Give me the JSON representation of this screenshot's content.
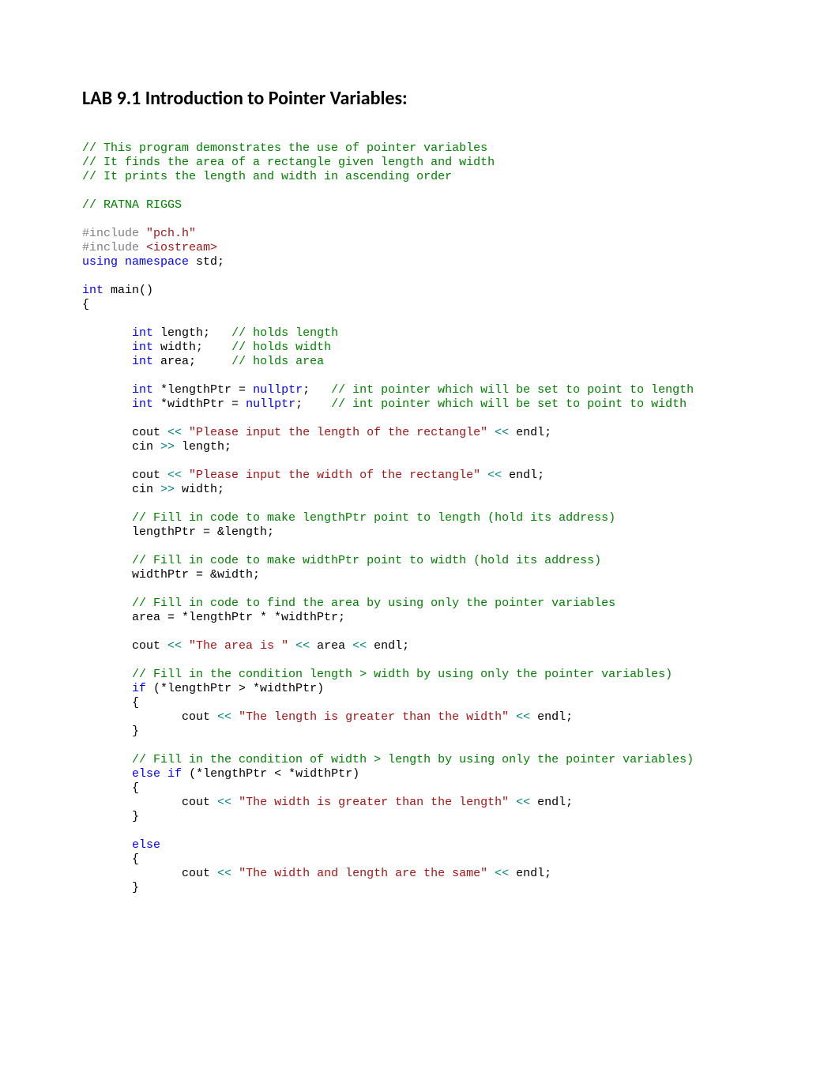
{
  "title": "LAB 9.1 Introduction to Pointer Variables:",
  "code": {
    "c1": "// This program demonstrates the use of pointer variables",
    "c2": "// It finds the area of a rectangle given length and width",
    "c3": "// It prints the length and width in ascending order",
    "c4": "// RATNA RIGGS",
    "inc": "#include",
    "pch": "\"pch.h\"",
    "ios": "<iostream>",
    "using": "using",
    "ns": "namespace",
    "std": " std;",
    "int": "int",
    "main": " main()",
    "lb": "{",
    "rb": "}",
    "length_decl": " length;   ",
    "c_len": "// holds length",
    "width_decl": " width;    ",
    "c_wid": "// holds width",
    "area_decl": " area;     ",
    "c_area": "// holds area",
    "lptr_decl": " *lengthPtr = ",
    "nullptr": "nullptr",
    "semic": ";",
    "lptr_pad": "   ",
    "c_lptr": "// int pointer which will be set to point to length",
    "wptr_decl": " *widthPtr = ",
    "wptr_pad": "    ",
    "c_wptr": "// int pointer which will be set to point to width",
    "cout": "cout ",
    "cin": "cin ",
    "ins": "<<",
    "ext": ">>",
    "s_inlen": " \"Please input the length of the rectangle\" ",
    "endl": " endl;",
    "cin_len": " length;",
    "s_inwid": " \"Please input the width of the rectangle\" ",
    "cin_wid": " width;",
    "c_fill_len": "// Fill in code to make lengthPtr point to length (hold its address)",
    "assign_len": "lengthPtr = &length;",
    "c_fill_wid": "// Fill in code to make widthPtr point to width (hold its address)",
    "assign_wid": "widthPtr = &width;",
    "c_fill_area": "// Fill in code to find the area by using only the pointer variables",
    "assign_area": "area = *lengthPtr * *widthPtr;",
    "s_area": " \"The area is \" ",
    "area_out": " area ",
    "c_cond1": "// Fill in the condition length > width by using only the pointer variables)",
    "if": "if",
    "cond1": " (*lengthPtr > *widthPtr)",
    "s_lgw": " \"The length is greater than the width\" ",
    "c_cond2": "// Fill in the condition of width > length by using only the pointer variables)",
    "else": "else",
    "elseif_cond": " (*lengthPtr < *widthPtr)",
    "s_wgl": " \"The width is greater than the length\" ",
    "s_same": " \"The width and length are the same\" "
  }
}
